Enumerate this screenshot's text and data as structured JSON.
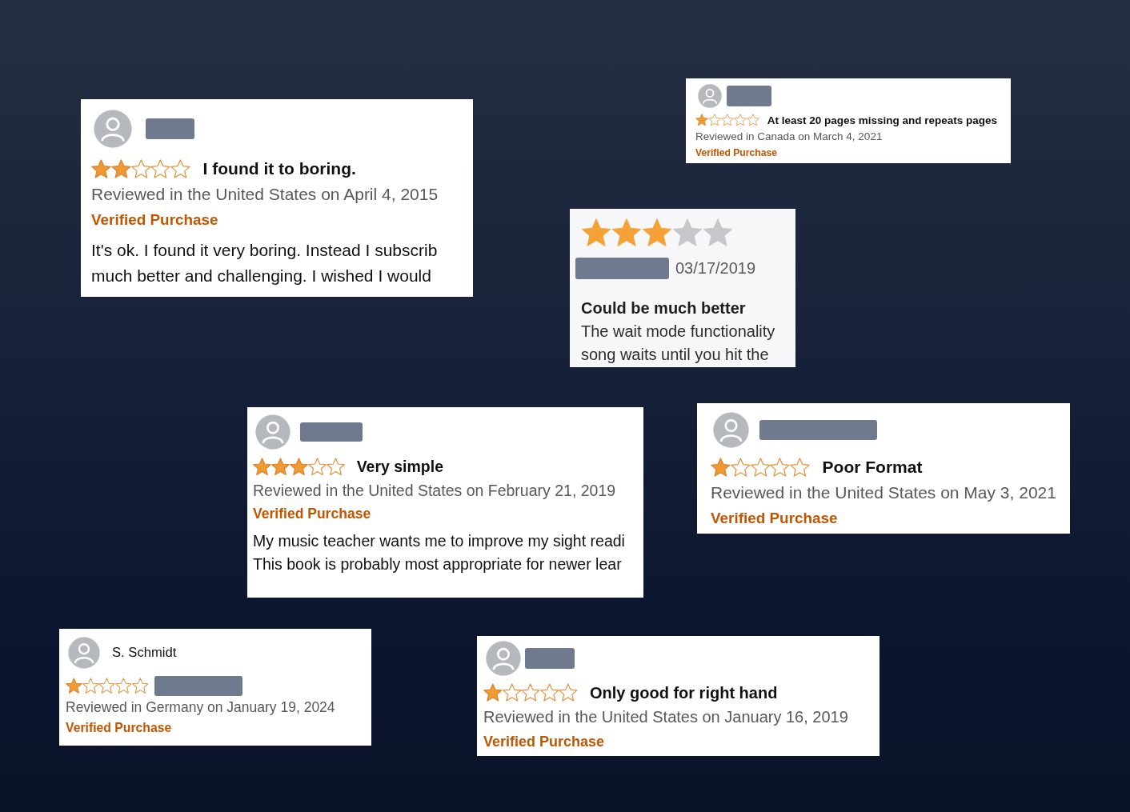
{
  "cards": [
    {
      "kind": "amazon",
      "name_redacted": true,
      "stars": 2,
      "title": "I found it to boring.",
      "title_redacted": false,
      "reviewed": "Reviewed in the United States on April 4, 2015",
      "verified": "Verified Purchase",
      "body": [
        "It's ok. I found it very boring. Instead I subscrib",
        "much better and challenging. I wished I would"
      ]
    },
    {
      "kind": "amazon",
      "name_redacted": true,
      "stars": 1,
      "title": "At least 20 pages missing and repeats pages",
      "title_redacted": false,
      "reviewed": "Reviewed in Canada on March 4, 2021",
      "verified": "Verified Purchase"
    },
    {
      "kind": "app",
      "stars": 3,
      "name_redacted": true,
      "date": "03/17/2019",
      "title": "Could be much better",
      "body": [
        "The wait mode functionality",
        "song waits until you hit the"
      ]
    },
    {
      "kind": "amazon",
      "name_redacted": true,
      "stars": 3,
      "title": "Very simple",
      "title_redacted": false,
      "reviewed": "Reviewed in the United States on February 21, 2019",
      "verified": "Verified Purchase",
      "body": [
        "My music teacher wants me to improve my sight readi",
        "This book is probably most appropriate for newer lear"
      ]
    },
    {
      "kind": "amazon",
      "name_redacted": true,
      "stars": 1,
      "title": "Poor Format",
      "title_redacted": false,
      "reviewed": "Reviewed in the United States on May 3, 2021",
      "verified": "Verified Purchase"
    },
    {
      "kind": "amazon",
      "name": "S. Schmidt",
      "name_redacted": false,
      "stars": 1,
      "title_redacted": true,
      "reviewed": "Reviewed in Germany on January 19, 2024",
      "verified": "Verified Purchase"
    },
    {
      "kind": "amazon",
      "name_redacted": true,
      "stars": 1,
      "title": "Only good for right hand",
      "title_redacted": false,
      "reviewed": "Reviewed in the United States on January 16, 2019",
      "verified": "Verified Purchase"
    }
  ]
}
